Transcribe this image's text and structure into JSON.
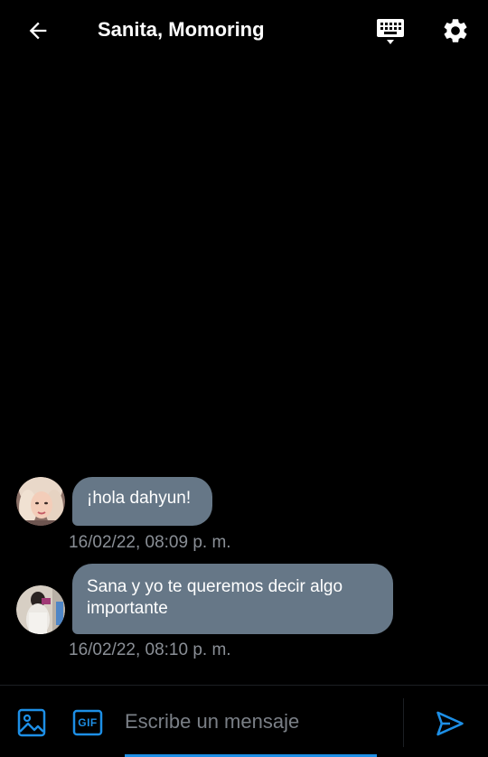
{
  "header": {
    "back_icon": "arrow-left-icon",
    "title": "Sanita, Momoring",
    "keyboard_icon": "keyboard-icon",
    "settings_icon": "gear-icon"
  },
  "messages": [
    {
      "text": "¡hola dahyun!",
      "timestamp": "16/02/22, 08:09 p. m.",
      "avatar": "avatar-blonde-selfie"
    },
    {
      "text": "Sana y yo te queremos decir algo importante",
      "timestamp": "16/02/22, 08:10 p. m.",
      "avatar": "avatar-mirror-selfie"
    }
  ],
  "composer": {
    "image_icon": "image-icon",
    "gif_label": "GIF",
    "placeholder": "Escribe un mensaje",
    "value": "",
    "send_icon": "send-icon"
  },
  "colors": {
    "background": "#000000",
    "bubble": "#667787",
    "accent": "#1d8fe6",
    "timestamp": "#8a8f96"
  }
}
